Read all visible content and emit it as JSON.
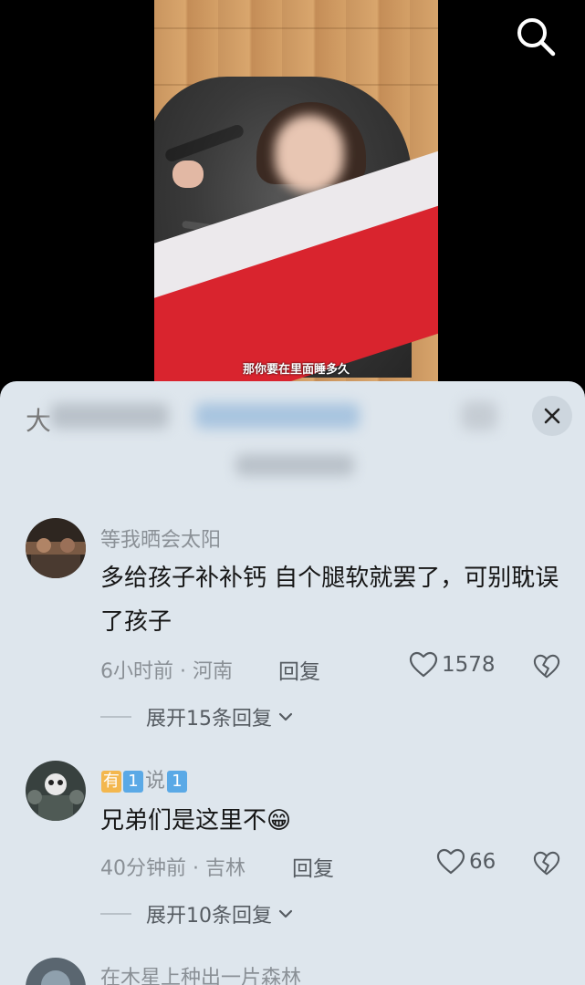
{
  "video": {
    "subtitle": "那你要在里面睡多久",
    "search_icon": "search-icon"
  },
  "sheet": {
    "header_letter": "大",
    "close_icon": "close-icon"
  },
  "comments": [
    {
      "username": "等我晒会太阳",
      "text": "多给孩子补补钙 自个腿软就罢了，可别耽误了孩子",
      "time": "6小时前 · 河南",
      "reply_label": "回复",
      "likes": "1578",
      "expand_label": "展开15条回复"
    },
    {
      "username_parts": [
        "有",
        "1",
        "说",
        "1"
      ],
      "text": "兄弟们是这里不",
      "emoji": "😁",
      "time": "40分钟前 · 吉林",
      "reply_label": "回复",
      "likes": "66",
      "expand_label": "展开10条回复"
    },
    {
      "username": "在木星上种出一片森林"
    }
  ],
  "colors": {
    "sheet_bg": "#dee6ed",
    "badge_orange": "#f3b74e",
    "badge_blue": "#5aa9e6",
    "text_primary": "#161616",
    "text_secondary": "#8a9096"
  }
}
